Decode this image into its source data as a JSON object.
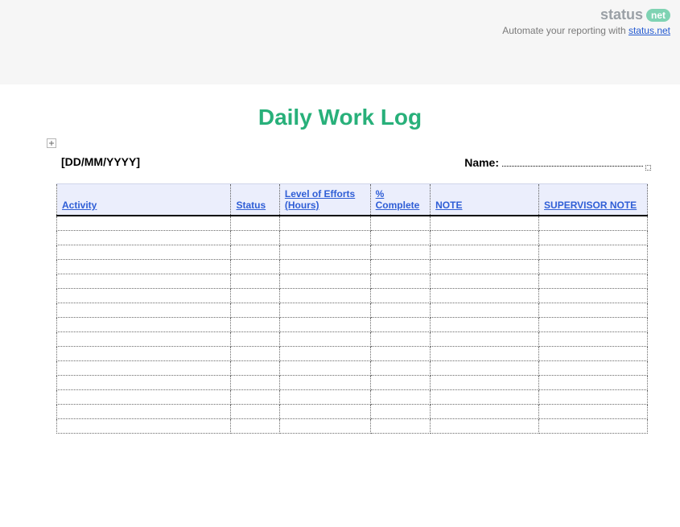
{
  "brand": {
    "name": "status",
    "badge": "net",
    "tagline_prefix": "Automate your reporting with ",
    "tagline_link": "status.net"
  },
  "title": "Daily Work Log",
  "meta": {
    "date_placeholder": "[DD/MM/YYYY]",
    "name_label": "Name:"
  },
  "table": {
    "headers": {
      "activity": "Activity",
      "status": "Status",
      "effort": "Level of Efforts (Hours)",
      "complete": "% Complete",
      "note": "NOTE",
      "supervisor_note": "SUPERVISOR NOTE"
    },
    "row_count": 15
  }
}
